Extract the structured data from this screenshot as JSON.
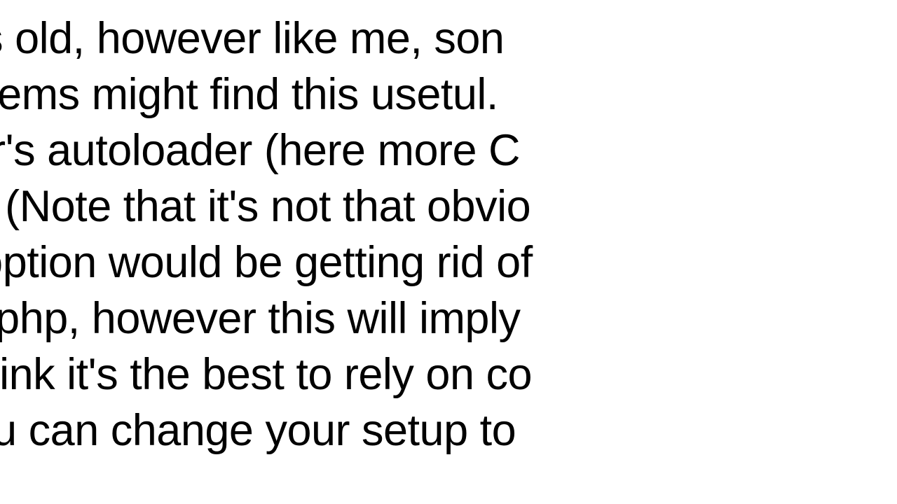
{
  "document": {
    "lines": [
      " I know it's old, however like me, son",
      "g old systems might find this usetul.",
      " composer's autoloader (here more C",
      "Kohana)) (Note that it's not that obvio",
      "Another option would be getting rid of",
      "ana/core.php, however this will imply",
      "ncies. I think it's the best to rely on co",
      "ader if you can change your setup to"
    ]
  }
}
